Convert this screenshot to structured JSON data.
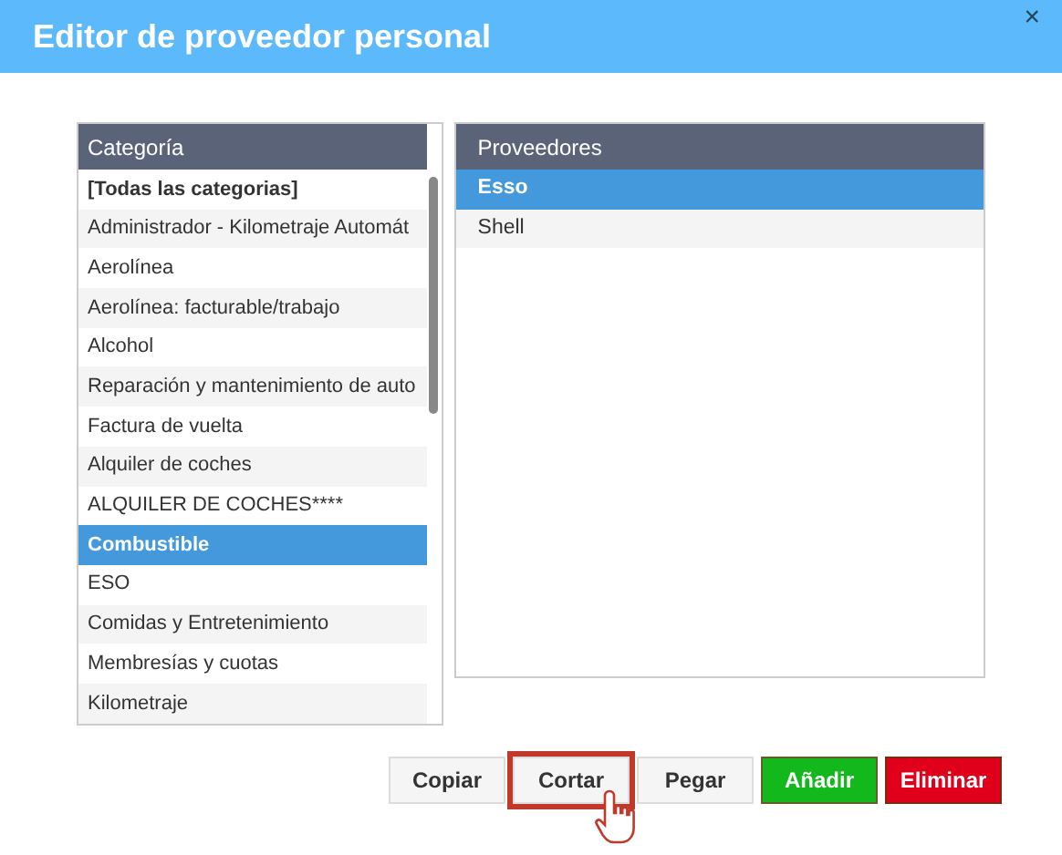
{
  "window": {
    "title": "Editor de proveedor personal",
    "close": "×"
  },
  "categories": {
    "header": "Categoría",
    "items": [
      {
        "label": "[Todas las categorias]",
        "bold": true,
        "selected": false
      },
      {
        "label": "Administrador - Kilometraje Automát",
        "bold": false,
        "selected": false
      },
      {
        "label": "Aerolínea",
        "bold": false,
        "selected": false
      },
      {
        "label": "Aerolínea: facturable/trabajo",
        "bold": false,
        "selected": false
      },
      {
        "label": "Alcohol",
        "bold": false,
        "selected": false
      },
      {
        "label": "Reparación y mantenimiento de auto",
        "bold": false,
        "selected": false
      },
      {
        "label": "Factura de vuelta",
        "bold": false,
        "selected": false
      },
      {
        "label": "Alquiler de coches",
        "bold": false,
        "selected": false
      },
      {
        "label": "ALQUILER DE COCHES****",
        "bold": false,
        "selected": false
      },
      {
        "label": "Combustible",
        "bold": false,
        "selected": true
      },
      {
        "label": "ESO",
        "bold": false,
        "selected": false
      },
      {
        "label": "Comidas y Entretenimiento",
        "bold": false,
        "selected": false
      },
      {
        "label": "Membresías y cuotas",
        "bold": false,
        "selected": false
      },
      {
        "label": "Kilometraje",
        "bold": false,
        "selected": false
      }
    ]
  },
  "providers": {
    "header": "Proveedores",
    "items": [
      {
        "label": "Esso",
        "selected": true
      },
      {
        "label": "Shell",
        "selected": false
      }
    ]
  },
  "buttons": [
    {
      "label": "Copiar",
      "kind": "plain",
      "highlighted": false
    },
    {
      "label": "Cortar",
      "kind": "plain",
      "highlighted": true
    },
    {
      "label": "Pegar",
      "kind": "plain",
      "highlighted": false
    },
    {
      "label": "Añadir",
      "kind": "add",
      "highlighted": false
    },
    {
      "label": "Eliminar",
      "kind": "delete",
      "highlighted": false
    }
  ]
}
